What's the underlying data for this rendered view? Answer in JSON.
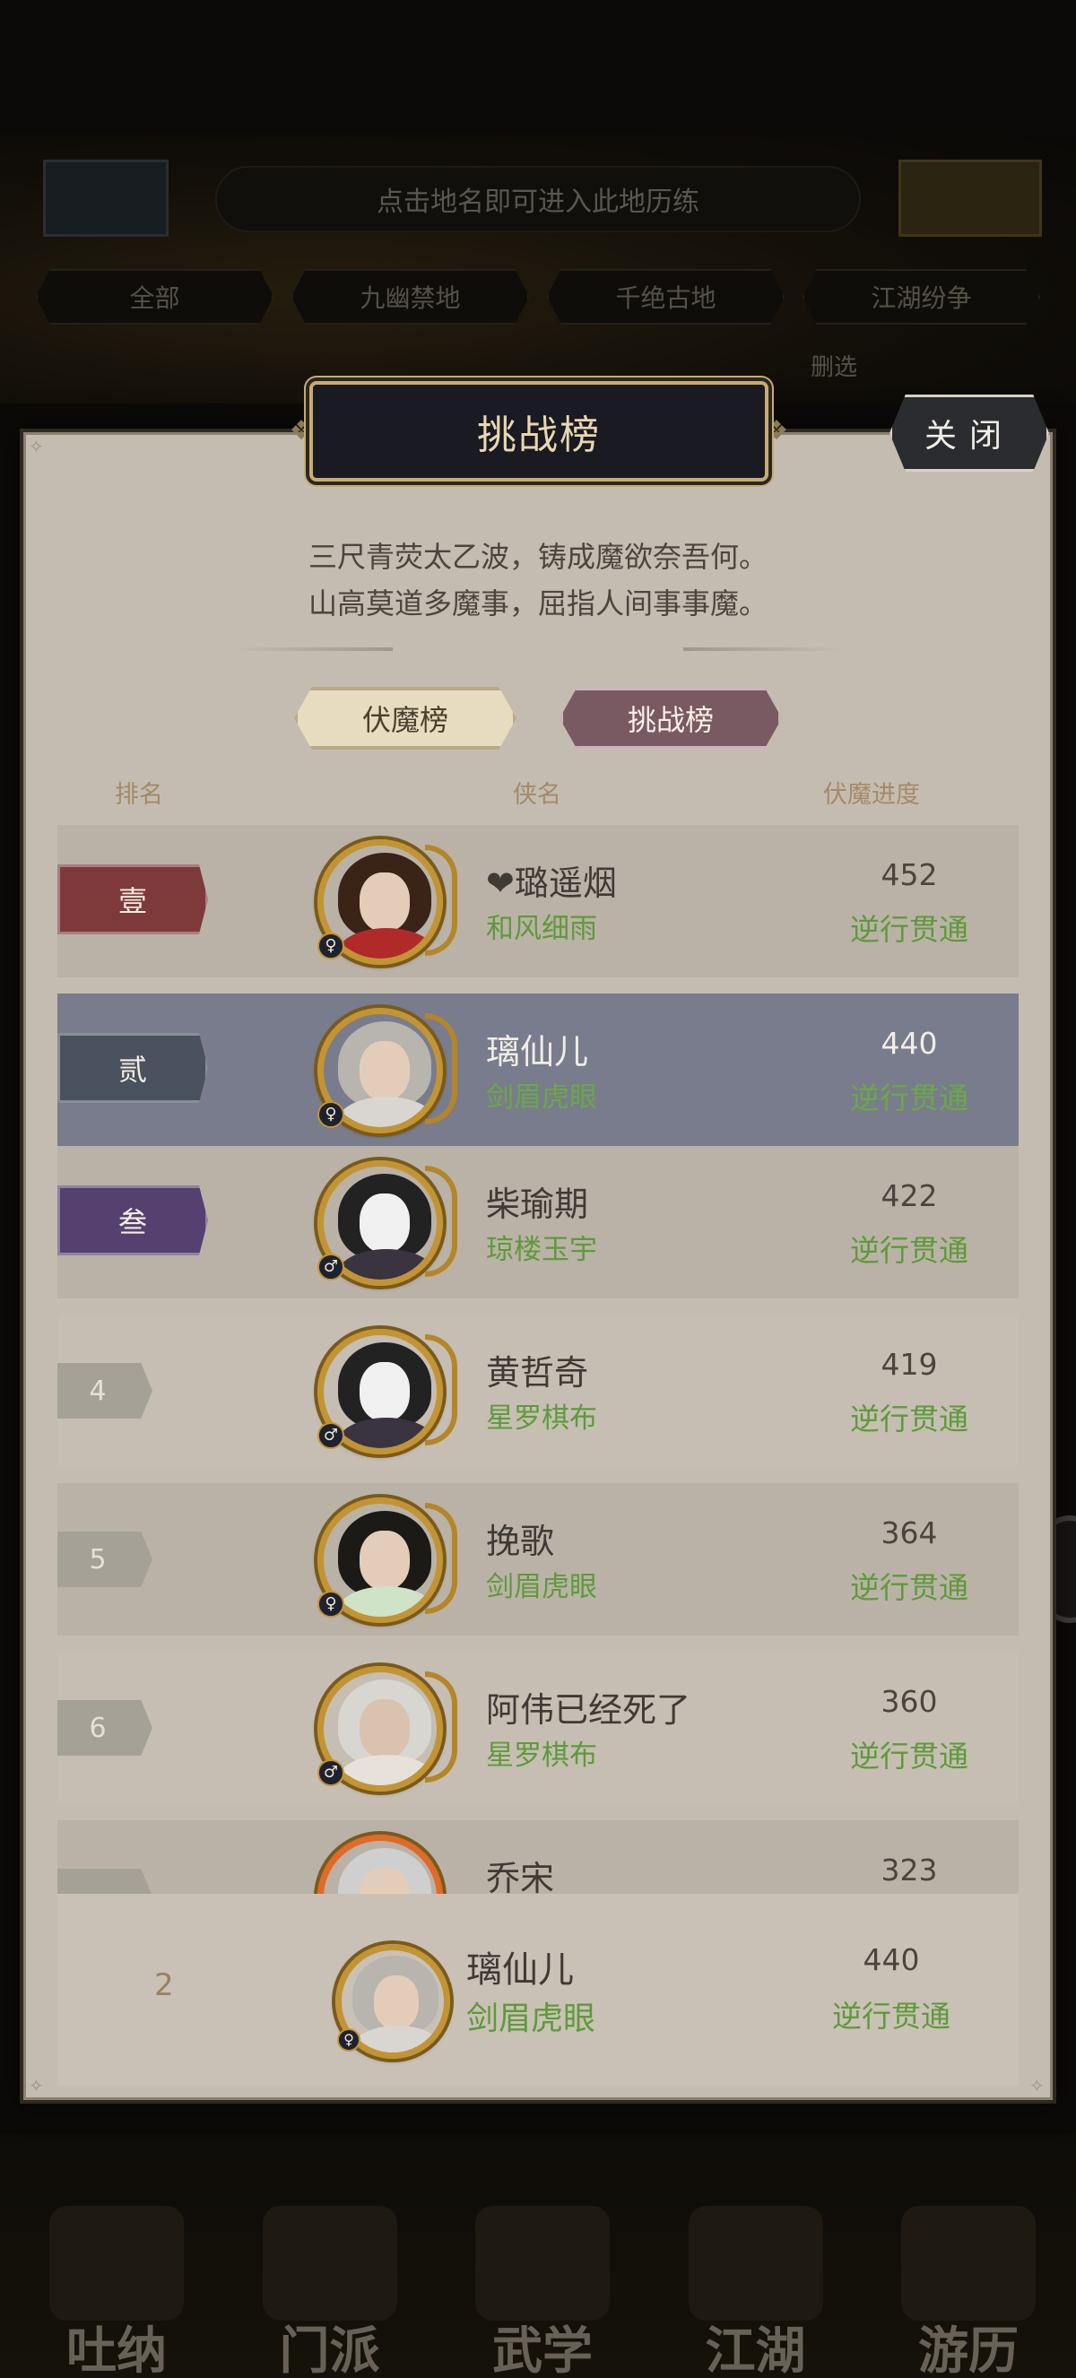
{
  "background": {
    "hint": "点击地名即可进入此地历练",
    "filters": [
      "全部",
      "九幽禁地",
      "千绝古地",
      "江湖纷争"
    ],
    "sub_label": "删选",
    "nav": [
      "吐纳",
      "门派",
      "武学",
      "江湖",
      "游历"
    ]
  },
  "modal": {
    "title": "挑战榜",
    "close_label": "关闭",
    "poem": [
      "三尺青荧太乙波，铸成魔欲奈吾何。",
      "山高莫道多魔事，屈指人间事事魔。"
    ],
    "tabs": [
      {
        "label": "伏魔榜",
        "active": false
      },
      {
        "label": "挑战榜",
        "active": true
      }
    ],
    "columns": {
      "rank": "排名",
      "name": "侠名",
      "progress": "伏魔进度"
    }
  },
  "rankings": [
    {
      "rank": "壹",
      "name": "❤璐遥烟",
      "title": "和风细雨",
      "score": "452",
      "progress": "逆行贯通",
      "gender": "♀",
      "badge_color": "#7e3a3a"
    },
    {
      "rank": "贰",
      "name": "璃仙儿",
      "title": "剑眉虎眼",
      "score": "440",
      "progress": "逆行贯通",
      "gender": "♀",
      "badge_color": "#4a5260"
    },
    {
      "rank": "叁",
      "name": "柴瑜期",
      "title": "琼楼玉宇",
      "score": "422",
      "progress": "逆行贯通",
      "gender": "♂",
      "badge_color": "#55406f"
    },
    {
      "rank": "4",
      "name": "黄哲奇",
      "title": "星罗棋布",
      "score": "419",
      "progress": "逆行贯通",
      "gender": "♂"
    },
    {
      "rank": "5",
      "name": "挽歌",
      "title": "剑眉虎眼",
      "score": "364",
      "progress": "逆行贯通",
      "gender": "♀"
    },
    {
      "rank": "6",
      "name": "阿伟已经死了",
      "title": "星罗棋布",
      "score": "360",
      "progress": "逆行贯通",
      "gender": "♂"
    },
    {
      "rank": "",
      "name": "乔宋",
      "title": "",
      "score": "323",
      "progress": "",
      "gender": ""
    }
  ],
  "my_rank": {
    "rank": "2",
    "name": "璃仙儿",
    "title": "剑眉虎眼",
    "score": "440",
    "progress": "逆行贯通",
    "gender": "♀"
  }
}
